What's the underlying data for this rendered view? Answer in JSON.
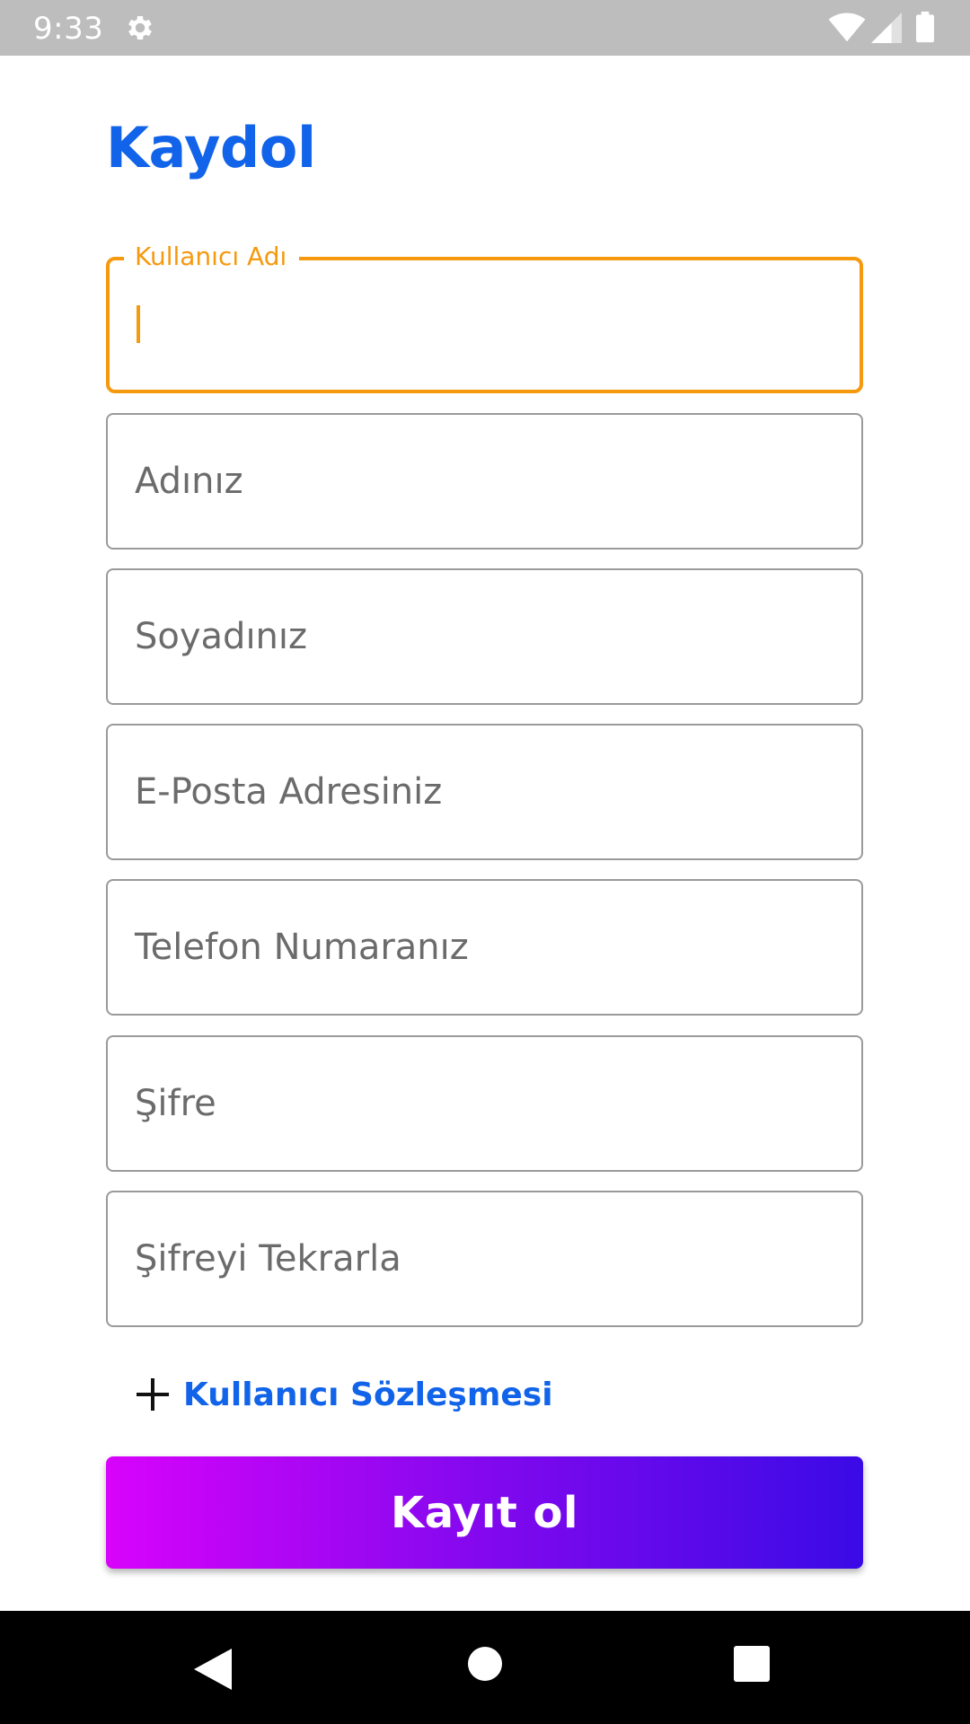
{
  "status_bar": {
    "time": "9:33",
    "icons": [
      "gear-icon",
      "wifi-icon",
      "cellular-signal-icon",
      "battery-icon"
    ]
  },
  "page": {
    "title": "Kaydol"
  },
  "form": {
    "username": {
      "label": "Kullanıcı Adı",
      "value": ""
    },
    "first_name": {
      "placeholder": "Adınız"
    },
    "last_name": {
      "placeholder": "Soyadınız"
    },
    "email": {
      "placeholder": "E-Posta Adresiniz"
    },
    "phone": {
      "placeholder": "Telefon Numaranız"
    },
    "password": {
      "placeholder": "Şifre"
    },
    "password_repeat": {
      "placeholder": "Şifreyi Tekrarla"
    }
  },
  "agreement": {
    "icon": "plus-icon",
    "label": "Kullanıcı Sözleşmesi"
  },
  "submit": {
    "label": "Kayıt ol"
  },
  "colors": {
    "title": "#1163e9",
    "focus": "#f5990f",
    "button_gradient_start": "#d803fb",
    "button_gradient_end": "#3a0ae6",
    "status_bar": "#bdbdbd",
    "nav_bar": "#000000"
  },
  "navigation_bar": {
    "icons": [
      "back-icon",
      "home-icon",
      "recents-icon"
    ]
  }
}
